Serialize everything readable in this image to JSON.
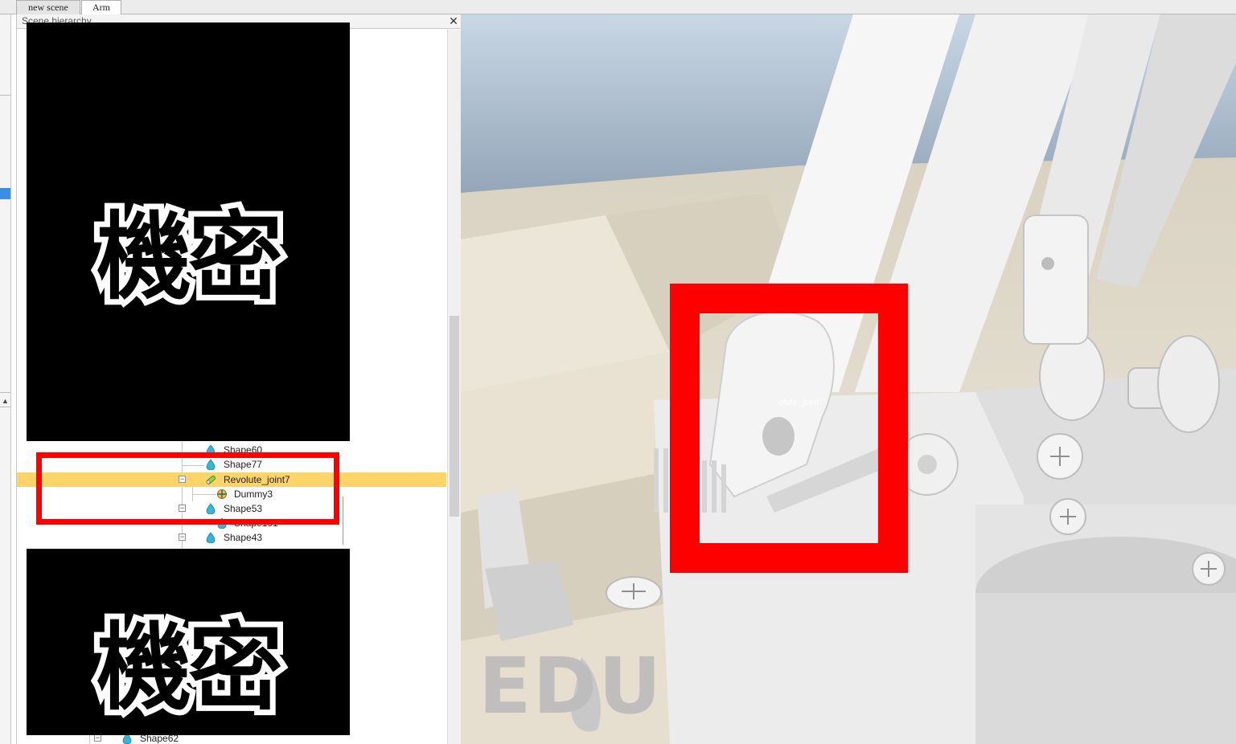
{
  "tabs": [
    {
      "label": "new scene"
    },
    {
      "label": "Arm"
    }
  ],
  "hierarchy": {
    "title": "Scene hierarchy",
    "close_glyph": "✕",
    "rows": [
      {
        "label": "Shape60",
        "icon": "shape-icon"
      },
      {
        "label": "Shape77",
        "icon": "shape-icon"
      },
      {
        "label": "Revolute_joint7",
        "icon": "joint-icon",
        "selected": true
      },
      {
        "label": "Dummy3",
        "icon": "dummy-icon"
      },
      {
        "label": "Shape53",
        "icon": "shape-icon"
      },
      {
        "label": "Shape101",
        "icon": "shape-icon"
      },
      {
        "label": "Shape43",
        "icon": "shape-icon"
      },
      {
        "label": "Shape62",
        "icon": "shape-icon"
      }
    ],
    "redaction_text": "機密"
  },
  "viewport": {
    "object_label": "olute_joint",
    "watermark": "EDU"
  },
  "colors": {
    "selection": "#fdd46a",
    "highlight_frame": "#ff0000",
    "sky_top": "#c9d7e4",
    "sky_bottom": "#92a4b8",
    "floor": "#e6e0d2",
    "model": "#f2f2f2"
  }
}
